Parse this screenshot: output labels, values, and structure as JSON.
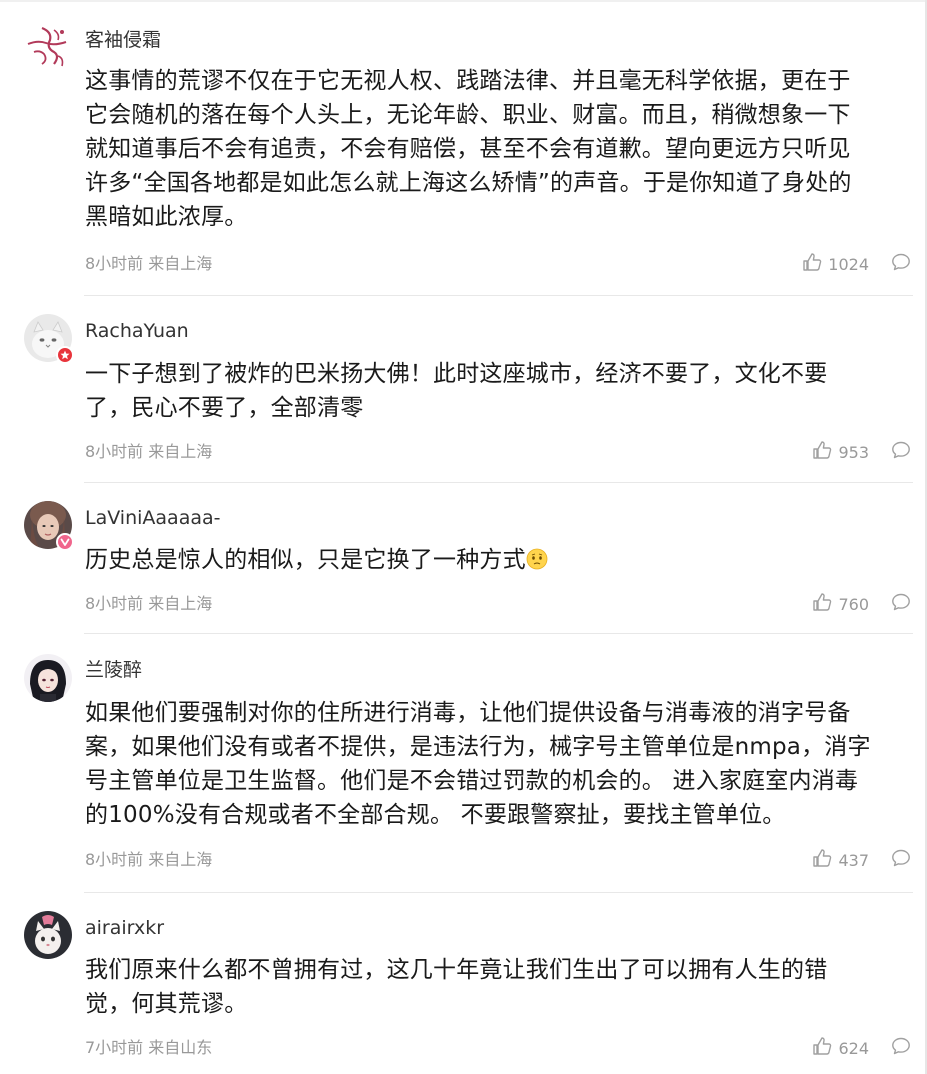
{
  "comments": [
    {
      "username": "客袖侵霜",
      "lines": [
        "这事情的荒谬不仅在于它无视人权、践踏法律、并且毫无科学依据，更在于",
        "它会随机的落在每个人头上，无论年龄、职业、财富。而且，稍微想象一下",
        "就知道事后不会有追责，不会有赔偿，甚至不会有道歉。望向更远方只听见",
        "许多“全国各地都是如此怎么就上海这么矫情”的声音。于是你知道了身处的",
        "黑暗如此浓厚。"
      ],
      "meta": "8小时前 来自上海",
      "likes": "1024",
      "avatar_icon": "calligraphy-avatar-icon"
    },
    {
      "username": "RachaYuan",
      "lines": [
        "一下子想到了被炸的巴米扬大佛！此时这座城市，经济不要了，文化不要",
        "了，民心不要了，全部清零"
      ],
      "meta": "8小时前 来自上海",
      "likes": "953",
      "avatar_icon": "cat-avatar-icon",
      "badge": {
        "color": "#e8343b",
        "icon": "star-badge-icon"
      }
    },
    {
      "username": "LaViniAaaaaa-",
      "lines": [
        "历史总是惊人的相似，只是它换了一种方式"
      ],
      "emoji": "sad-face-emoji",
      "meta": "8小时前 来自上海",
      "likes": "760",
      "avatar_icon": "portrait-avatar-icon",
      "badge": {
        "color": "#f0668c",
        "icon": "v-badge-icon"
      }
    },
    {
      "username": "兰陵醉",
      "lines": [
        "如果他们要强制对你的住所进行消毒，让他们提供设备与消毒液的消字号备",
        "案，如果他们没有或者不提供，是违法行为，械字号主管单位是nmpa，消字",
        "号主管单位是卫生监督。他们是不会错过罚款的机会的。 进入家庭室内消毒",
        "的100%没有合规或者不全部合规。 不要跟警察扯，要找主管单位。"
      ],
      "meta": "8小时前 来自上海",
      "likes": "437",
      "avatar_icon": "anime-avatar-icon"
    },
    {
      "username": "airairxkr",
      "lines": [
        "我们原来什么都不曾拥有过，这几十年竟让我们生出了可以拥有人生的错",
        "觉，何其荒谬。"
      ],
      "meta": "7小时前 来自山东",
      "likes": "624",
      "avatar_icon": "pet-avatar-icon"
    }
  ],
  "colors": {
    "text": "#1a1a1a",
    "username": "#333333",
    "meta": "#999999",
    "divider": "#e8e8e8"
  }
}
